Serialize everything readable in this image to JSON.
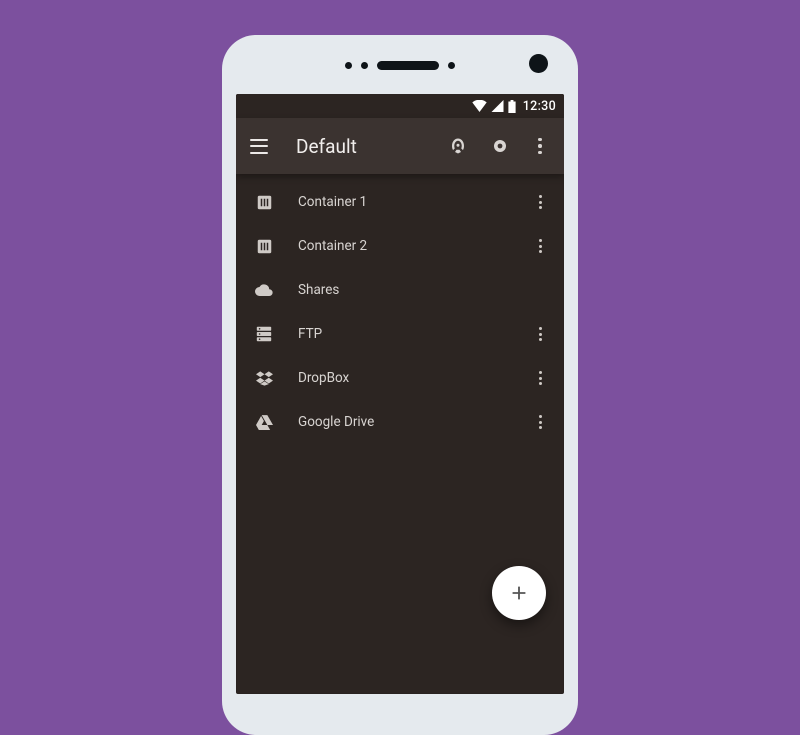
{
  "statusbar": {
    "time": "12:30"
  },
  "appbar": {
    "title": "Default"
  },
  "items": [
    {
      "label": "Container 1",
      "icon": "container",
      "menu": true
    },
    {
      "label": "Container 2",
      "icon": "container",
      "menu": true
    },
    {
      "label": "Shares",
      "icon": "cloud",
      "menu": false
    },
    {
      "label": "FTP",
      "icon": "server",
      "menu": true
    },
    {
      "label": "DropBox",
      "icon": "dropbox",
      "menu": true
    },
    {
      "label": "Google Drive",
      "icon": "gdrive",
      "menu": true
    }
  ],
  "fab": {
    "label": "+"
  }
}
